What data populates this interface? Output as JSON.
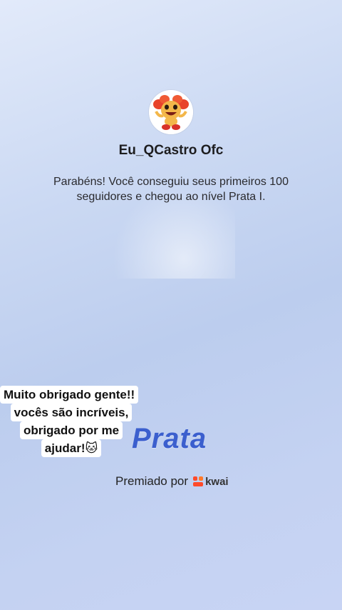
{
  "profile": {
    "username": "Eu_QCastro Ofc",
    "avatar_icon": "cartoon-character-avatar"
  },
  "message": "Parabéns! Você conseguiu seus primeiros 100 seguidores e chegou ao nível Prata I.",
  "caption": {
    "lines": [
      "Muito obrigado gente!!",
      "vocês são incríveis,",
      "obrigado por me",
      "ajudar!🐱"
    ]
  },
  "level": {
    "label": "Prata",
    "color": "#3b5fce"
  },
  "footer": {
    "awarded_by": "Premiado por",
    "brand_name": "kwai",
    "brand_color": "#ff4a2a"
  }
}
